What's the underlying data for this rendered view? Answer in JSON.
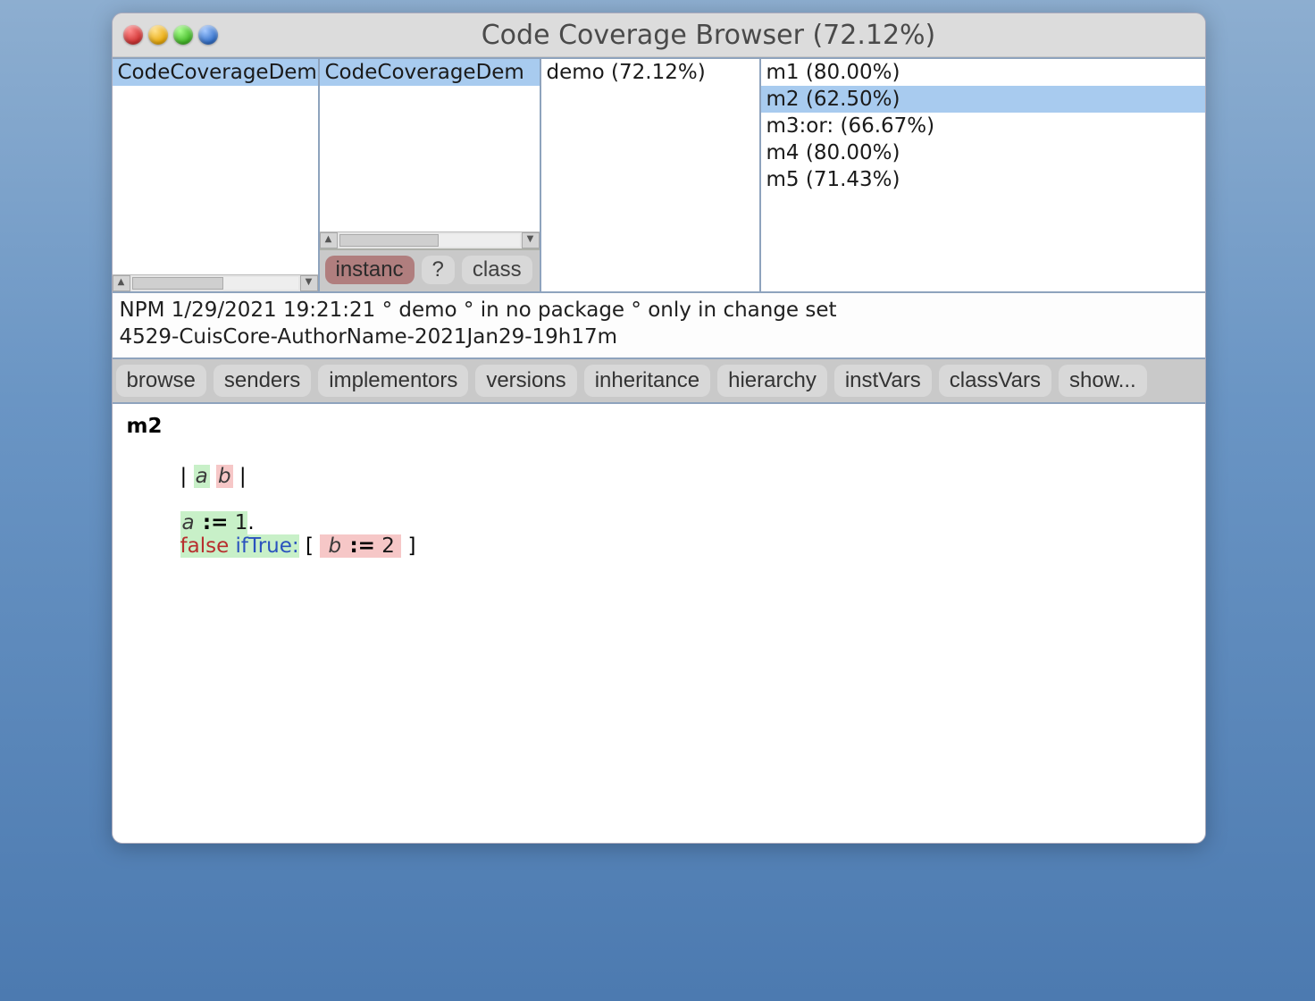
{
  "window": {
    "title": "Code Coverage Browser (72.12%)"
  },
  "packages": {
    "items": [
      "CodeCoverageDem"
    ],
    "selected": 0
  },
  "classes": {
    "items": [
      "CodeCoverageDem"
    ],
    "selected": 0
  },
  "protocols": {
    "items": [
      "demo (72.12%)"
    ],
    "selected": -1
  },
  "methods": {
    "items": [
      "m1 (80.00%)",
      "m2 (62.50%)",
      "m3:or: (66.67%)",
      "m4 (80.00%)",
      "m5 (71.43%)"
    ],
    "selected": 1
  },
  "switch": {
    "instance": "instanc",
    "help": "?",
    "class": "class",
    "active": "instance"
  },
  "annotation": {
    "line1": "NPM 1/29/2021 19:21:21 ° demo ° in no package ° only in change set",
    "line2": "4529-CuisCore-AuthorName-2021Jan29-19h17m"
  },
  "buttons": [
    "browse",
    "senders",
    "implementors",
    "versions",
    "inheritance",
    "hierarchy",
    "instVars",
    "classVars",
    "show..."
  ],
  "code": {
    "methodName": "m2",
    "temps": {
      "a_covered": "a",
      "b_uncovered": "b"
    },
    "line1": {
      "lhs": "a",
      "op": ":=",
      "rhs": "1",
      "trail": "."
    },
    "line2": {
      "rcvr": "false",
      "msg": "ifTrue:",
      "open": "[",
      "blk_lhs": "b",
      "blk_op": ":=",
      "blk_rhs": "2",
      "close": "]"
    }
  }
}
